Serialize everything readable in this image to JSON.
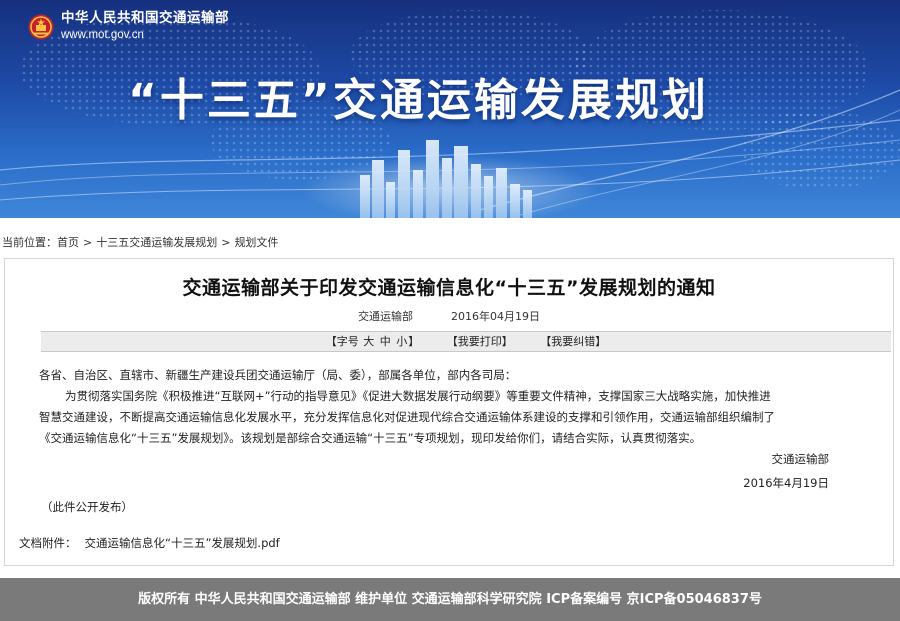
{
  "site": {
    "name": "中华人民共和国交通运输部",
    "url": "www.mot.gov.cn",
    "banner_title": "“十三五”交通运输发展规划"
  },
  "breadcrumb": {
    "prefix": "当前位置：",
    "items": [
      "首页",
      "十三五交通运输发展规划",
      "规划文件"
    ],
    "separator": ">"
  },
  "article": {
    "title": "交通运输部关于印发交通运输信息化“十三五”发展规划的通知",
    "source": "交通运输部",
    "date": "2016年04月19日",
    "toolbar": {
      "font_size_label": "【字号",
      "font_large": "大",
      "font_medium": "中",
      "font_small": "小",
      "font_close": "】",
      "print": "【我要打印】",
      "correction": "【我要纠错】"
    },
    "salutation": "各省、自治区、直辖市、新疆生产建设兵团交通运输厅（局、委），部属各单位，部内各司局：",
    "paragraph_lines": [
      "为贯彻落实国务院《积极推进“互联网+”行动的指导意见》《促进大数据发展行动纲要》等重要文件精神，支撑国家三大战略实施，加快推进",
      "智慧交通建设，不断提高交通运输信息化发展水平，充分发挥信息化对促进现代综合交通运输体系建设的支撑和引领作用，交通运输部组织编制了",
      "《交通运输信息化“十三五”发展规划》。该规划是部综合交通运输“十三五”专项规划，现印发给你们，请结合实际，认真贯彻落实。"
    ],
    "signature_org": "交通运输部",
    "signature_date": "2016年4月19日",
    "public_note": "（此件公开发布）",
    "attachment_label": "文档附件：",
    "attachment_file": "交通运输信息化“十三五”发展规划.pdf"
  },
  "footer": {
    "text": "版权所有 中华人民共和国交通运输部 维护单位 交通运输部科学研究院 ICP备案编号 京ICP备05046837号"
  },
  "colors": {
    "banner_dark": "#16307e",
    "banner_light": "#3f86d8",
    "footer_bg": "#7a7a7a",
    "toolbar_bg": "#ececec"
  },
  "icons": [
    "national-emblem-icon"
  ]
}
